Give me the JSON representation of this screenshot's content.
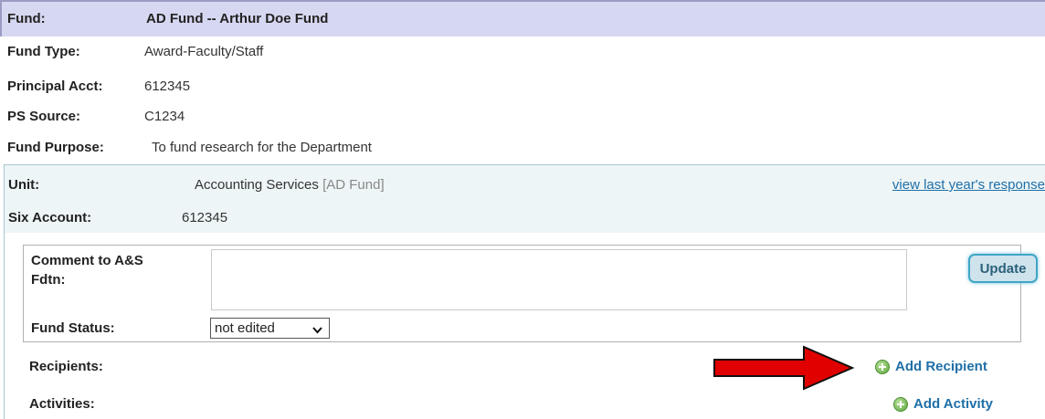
{
  "fund": {
    "label": "Fund:",
    "value": "AD Fund -- Arthur Doe Fund"
  },
  "details": [
    {
      "label": "Fund Type:",
      "value": "Award-Faculty/Staff"
    },
    {
      "label": "Principal Acct:",
      "value": "612345"
    },
    {
      "label": "PS Source:",
      "value": "C1234"
    },
    {
      "label": "Fund Purpose:",
      "value": "To fund research for the Department"
    }
  ],
  "unit": {
    "label": "Unit:",
    "value": "Accounting Services",
    "tag": "[AD Fund]",
    "view_link": "view last year's response",
    "account_label": "Six Account:",
    "account_value": "612345"
  },
  "comment": {
    "label_line1": "Comment to A&S",
    "label_line2": "Fdtn:",
    "value": "",
    "update_label": "Update"
  },
  "status": {
    "label": "Fund Status:",
    "selected": "not edited"
  },
  "recipients": {
    "label": "Recipients:",
    "add_label": "Add Recipient"
  },
  "activities": {
    "label": "Activities:",
    "add_label": "Add Activity"
  },
  "colors": {
    "header_bg": "#d6d7f1",
    "unit_bg": "#eef5f7",
    "link": "#1f6fa8",
    "arrow": "#e00000",
    "plus_icon": "#5aa83c"
  },
  "icons": {
    "chevron": "chevron-down-icon",
    "plus": "plus-circle-icon",
    "arrow": "red-arrow-icon"
  }
}
